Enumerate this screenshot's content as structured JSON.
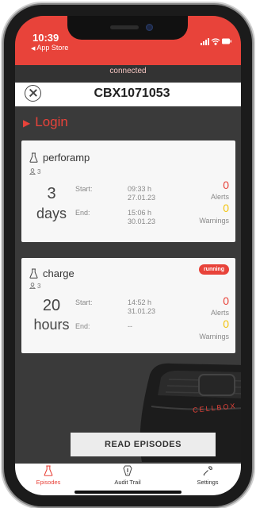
{
  "status_bar": {
    "time": "10:39",
    "back_label": "App Store"
  },
  "connection_status": "connected",
  "device": {
    "name": "CBX1071053"
  },
  "login_label": "Login",
  "episodes": [
    {
      "name": "perforamp",
      "users": "3",
      "duration_value": "3",
      "duration_unit": "days",
      "start_label": "Start:",
      "start_time": "09:33 h",
      "start_date": "27.01.23",
      "end_label": "End:",
      "end_time": "15:06 h",
      "end_date": "30.01.23",
      "alerts_count": "0",
      "alerts_label": "Alerts",
      "warnings_count": "0",
      "warnings_label": "Warnings",
      "status": ""
    },
    {
      "name": "charge",
      "users": "3",
      "duration_value": "20",
      "duration_unit": "hours",
      "start_label": "Start:",
      "start_time": "14:52 h",
      "start_date": "31.01.23",
      "end_label": "End:",
      "end_value": "--",
      "alerts_count": "0",
      "alerts_label": "Alerts",
      "warnings_count": "0",
      "warnings_label": "Warnings",
      "status": "running"
    }
  ],
  "brand_text": "CELLBOX",
  "read_button_label": "READ EPISODES",
  "nav": [
    {
      "label": "Episodes",
      "icon": "flask-icon",
      "active": true
    },
    {
      "label": "Audit Trail",
      "icon": "audit-trail-icon",
      "active": false
    },
    {
      "label": "Settings",
      "icon": "wrench-icon",
      "active": false
    }
  ],
  "colors": {
    "accent": "#e8433a",
    "warning": "#f2c511",
    "background": "#3a3a3a"
  }
}
